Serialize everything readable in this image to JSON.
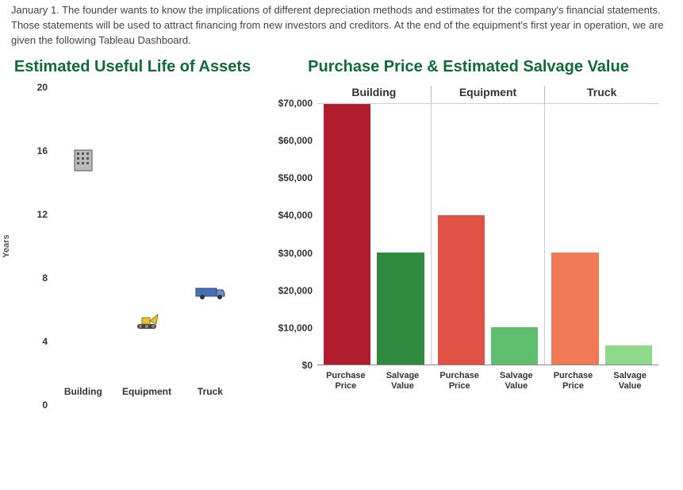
{
  "intro": "January 1. The founder wants to know the implications of different depreciation methods and estimates for the company's financial statements. Those statements will be used to attract financing from new investors and creditors. At the end of the equipment's first year in operation, we are given the following Tableau Dashboard.",
  "left": {
    "title": "Estimated Useful Life of Assets",
    "ylabel": "Years",
    "yticks": [
      "20",
      "16",
      "12",
      "8",
      "4",
      "0"
    ],
    "xcats": [
      "Building",
      "Equipment",
      "Truck"
    ]
  },
  "right": {
    "title": "Purchase Price & Estimated Salvage Value",
    "headers": [
      "Building",
      "Equipment",
      "Truck"
    ],
    "yticks": [
      "$70,000",
      "$60,000",
      "$50,000",
      "$40,000",
      "$30,000",
      "$20,000",
      "$10,000",
      "$0"
    ],
    "sublabels": {
      "p": "Purchase Price",
      "s": "Salvage Value"
    }
  },
  "chart_data": [
    {
      "type": "scatter",
      "title": "Estimated Useful Life of Assets",
      "xlabel": "",
      "ylabel": "Years",
      "ylim": [
        0,
        20
      ],
      "categories": [
        "Building",
        "Equipment",
        "Truck"
      ],
      "values": [
        15,
        4,
        6
      ]
    },
    {
      "type": "bar",
      "title": "Purchase Price & Estimated Salvage Value",
      "ylabel": "",
      "ylim": [
        0,
        70000
      ],
      "categories": [
        "Building",
        "Equipment",
        "Truck"
      ],
      "series": [
        {
          "name": "Purchase Price",
          "values": [
            70000,
            40000,
            30000
          ]
        },
        {
          "name": "Salvage Value",
          "values": [
            30000,
            10000,
            5000
          ]
        }
      ],
      "colors": {
        "Building": {
          "Purchase Price": "#b11d2c",
          "Salvage Value": "#2d8a3e"
        },
        "Equipment": {
          "Purchase Price": "#e15146",
          "Salvage Value": "#5fbf6e"
        },
        "Truck": {
          "Purchase Price": "#f07a55",
          "Salvage Value": "#8fd98a"
        }
      }
    }
  ]
}
